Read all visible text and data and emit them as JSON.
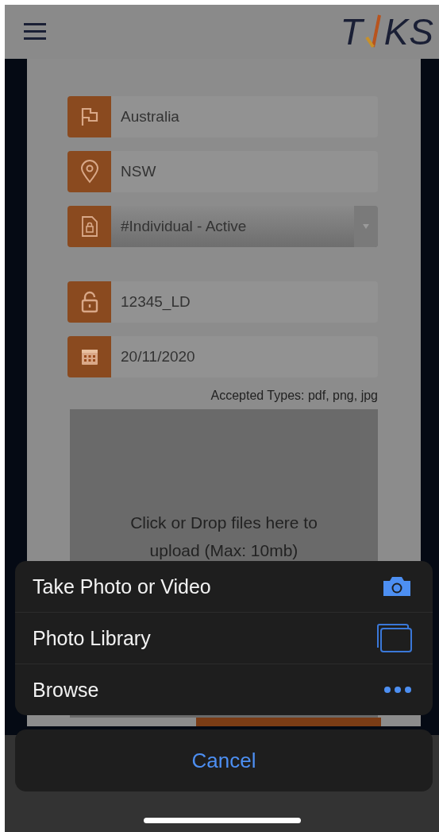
{
  "header": {
    "logo": {
      "left": "T",
      "right": "KS"
    }
  },
  "form": {
    "field_groups": [
      [
        {
          "kind": "text",
          "value": "Australia"
        },
        {
          "kind": "text",
          "value": "NSW"
        },
        {
          "kind": "select",
          "value": "#Individual - Active"
        }
      ],
      [
        {
          "kind": "text",
          "value": "12345_LD"
        },
        {
          "kind": "text",
          "value": "20/11/2020"
        }
      ]
    ],
    "accepted_types": "Accepted Types: pdf, png, jpg",
    "dropzone": "Click or Drop files here to upload (Max: 10mb)"
  },
  "action_sheet": {
    "options": [
      {
        "label": "Take Photo or Video"
      },
      {
        "label": "Photo Library"
      },
      {
        "label": "Browse"
      }
    ],
    "cancel": "Cancel"
  }
}
